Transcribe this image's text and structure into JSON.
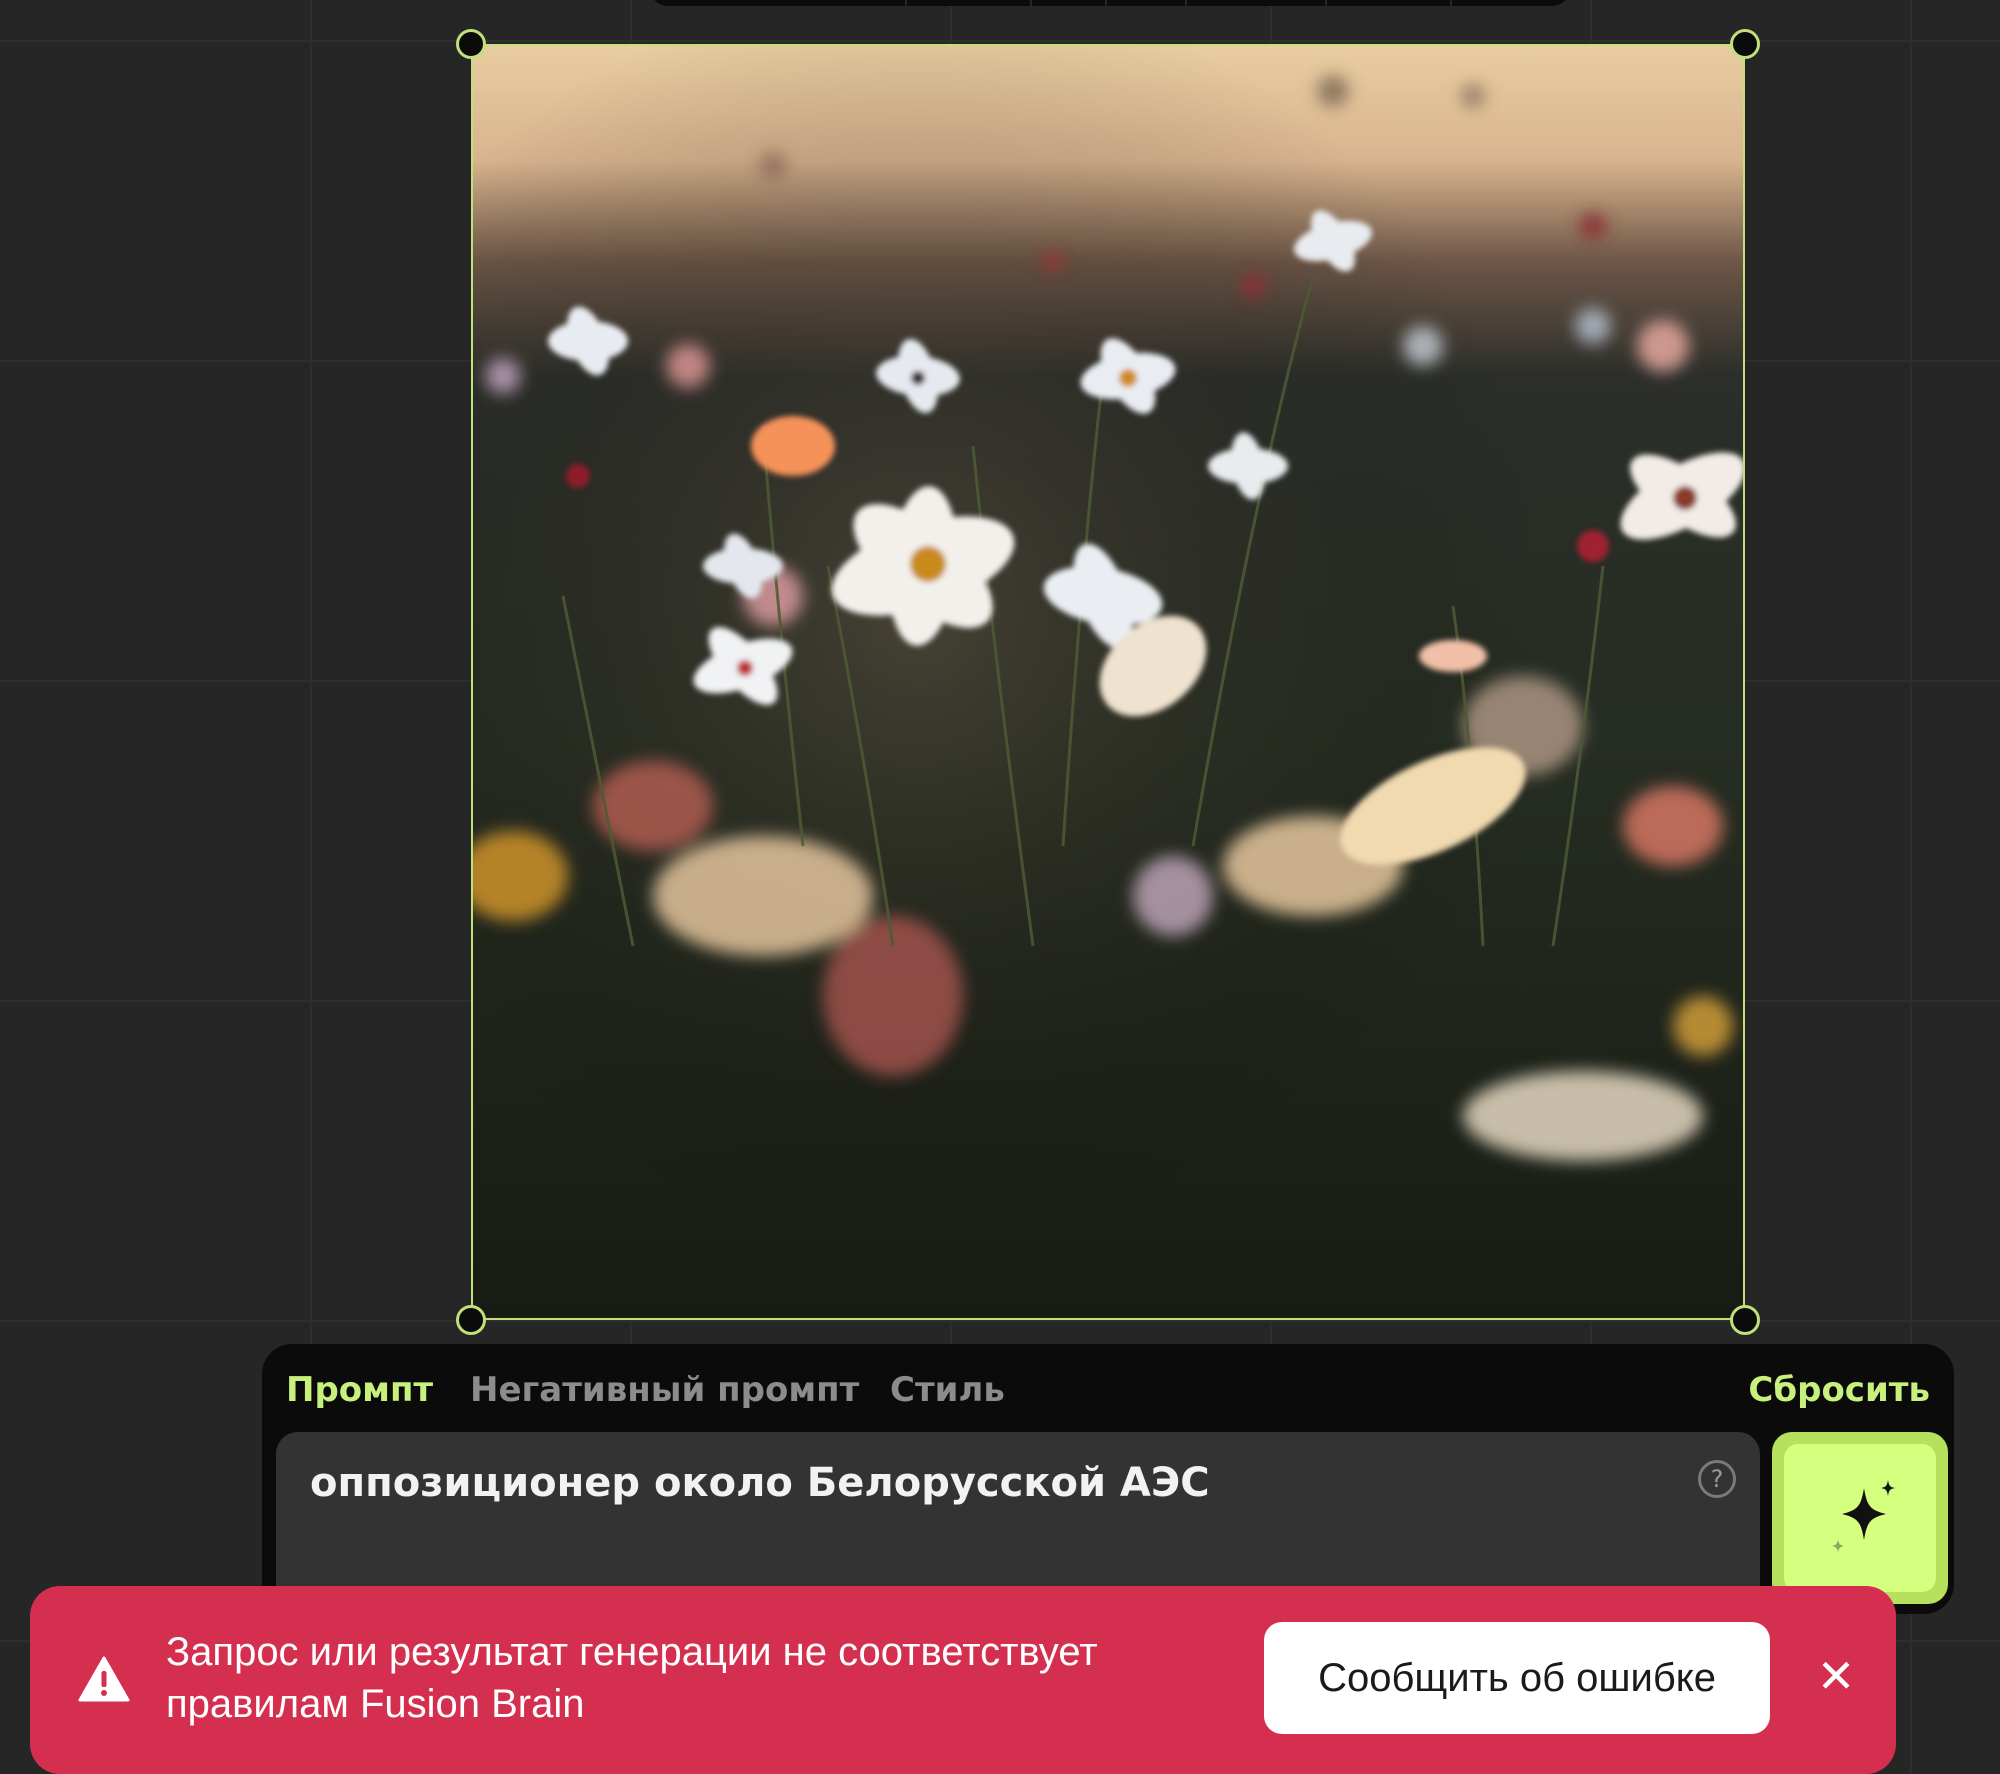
{
  "prompt_panel": {
    "tabs": [
      {
        "label": "Промпт",
        "active": true
      },
      {
        "label": "Негативный промпт",
        "active": false
      },
      {
        "label": "Стиль",
        "active": false
      }
    ],
    "reset_label": "Сбросить",
    "prompt_value": "оппозиционер около Белорусской АЭС",
    "help_icon": "question-icon",
    "generate_icon": "sparkle-icon"
  },
  "toast": {
    "message": "Запрос или результат генерации не соответствует правилам Fusion Brain",
    "report_label": "Сообщить об ошибке",
    "warning_icon": "warning-icon",
    "close_icon": "close-icon"
  },
  "colors": {
    "accent": "#c8f07c",
    "generate_bg": "#d5ff7e",
    "toast_bg": "#d52f4f",
    "canvas_bg": "#262626"
  }
}
